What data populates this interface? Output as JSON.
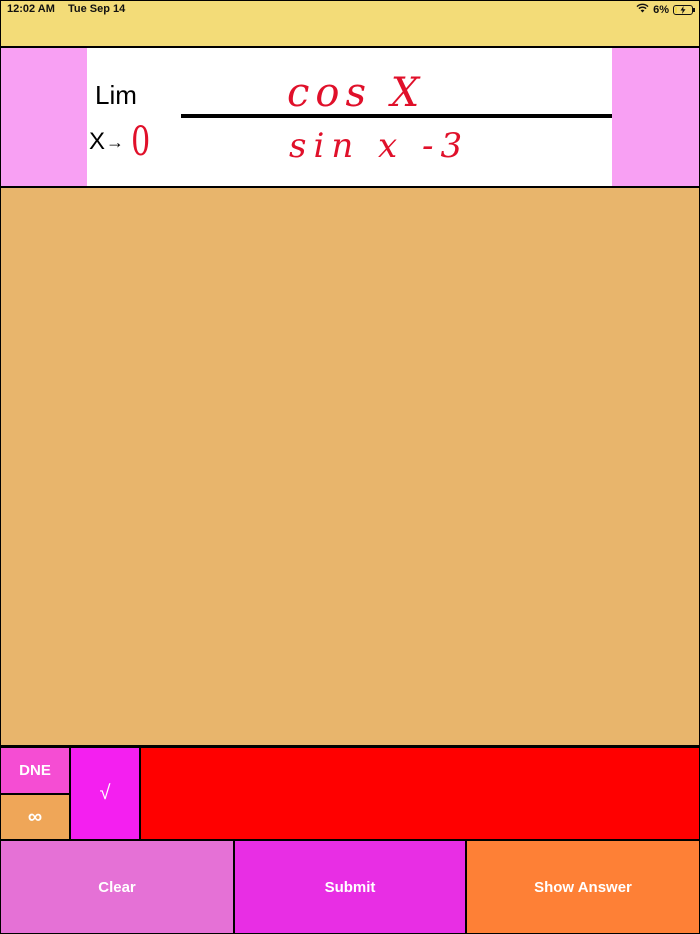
{
  "status_bar": {
    "time": "12:02 AM",
    "date": "Tue Sep 14",
    "battery": "6%",
    "wifi_icon": "wifi-icon",
    "battery_icon": "battery-charging-icon"
  },
  "problem": {
    "lim_label": "Lim",
    "variable": "X",
    "arrow": "→",
    "approach_value": "0",
    "numerator": "cos X",
    "denominator": "sin x  -3"
  },
  "keypad": {
    "dne_label": "DNE",
    "infinity_label": "∞",
    "sqrt_label": "√",
    "answer_value": ""
  },
  "actions": {
    "clear_label": "Clear",
    "submit_label": "Submit",
    "show_answer_label": "Show Answer"
  },
  "colors": {
    "header": "#f3dc78",
    "problem_band": "#f8a0f3",
    "work_area": "#e8b56c",
    "dne": "#f54dd3",
    "infinity": "#efa658",
    "sqrt": "#f41ff0",
    "answer_field": "#ff0000",
    "clear": "#e571d6",
    "submit": "#e82ee4",
    "show_answer": "#fe8036",
    "handwriting": "#e0102a"
  }
}
